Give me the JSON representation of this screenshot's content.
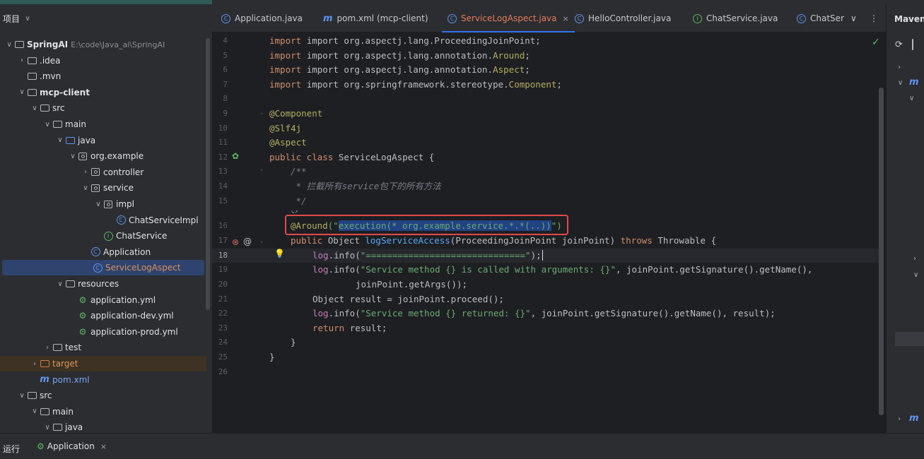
{
  "project_panel": {
    "title": "项目",
    "tree": [
      {
        "label": "SpringAI",
        "path": "E:\\code\\Java_ai\\SpringAI",
        "type": "module",
        "depth": 0,
        "expanded": true
      },
      {
        "label": ".idea",
        "type": "folder",
        "depth": 1,
        "expanded": false
      },
      {
        "label": ".mvn",
        "type": "folder",
        "depth": 1,
        "leaf": true
      },
      {
        "label": "mcp-client",
        "type": "module",
        "depth": 1,
        "expanded": true
      },
      {
        "label": "src",
        "type": "folder",
        "depth": 2,
        "expanded": true
      },
      {
        "label": "main",
        "type": "folder",
        "depth": 3,
        "expanded": true
      },
      {
        "label": "java",
        "type": "source-folder",
        "depth": 4,
        "expanded": true
      },
      {
        "label": "org.example",
        "type": "package",
        "depth": 5,
        "expanded": true
      },
      {
        "label": "controller",
        "type": "package",
        "depth": 6,
        "expanded": false
      },
      {
        "label": "service",
        "type": "package",
        "depth": 6,
        "expanded": true
      },
      {
        "label": "impl",
        "type": "package",
        "depth": 7,
        "expanded": true
      },
      {
        "label": "ChatServiceImpl",
        "type": "class",
        "depth": 8
      },
      {
        "label": "ChatService",
        "type": "interface",
        "depth": 7
      },
      {
        "label": "Application",
        "type": "class-run",
        "depth": 6
      },
      {
        "label": "ServiceLogAspect",
        "type": "class",
        "depth": 6,
        "selected": true
      },
      {
        "label": "resources",
        "type": "resources",
        "depth": 4,
        "expanded": true
      },
      {
        "label": "application.yml",
        "type": "yml",
        "depth": 5
      },
      {
        "label": "application-dev.yml",
        "type": "yml",
        "depth": 5
      },
      {
        "label": "application-prod.yml",
        "type": "yml",
        "depth": 5
      },
      {
        "label": "test",
        "type": "folder",
        "depth": 3,
        "expanded": false
      },
      {
        "label": "target",
        "type": "excluded",
        "depth": 2,
        "expanded": false,
        "highlight": true
      },
      {
        "label": "pom.xml",
        "type": "maven",
        "depth": 2
      },
      {
        "label": "src",
        "type": "folder",
        "depth": 1,
        "expanded": true
      },
      {
        "label": "main",
        "type": "folder",
        "depth": 2,
        "expanded": true
      },
      {
        "label": "java",
        "type": "folder",
        "depth": 3,
        "expanded": true
      }
    ]
  },
  "tabs": [
    {
      "label": "Application.java",
      "icon": "class-run-icon"
    },
    {
      "label": "pom.xml (mcp-client)",
      "icon": "maven-icon"
    },
    {
      "label": "ServiceLogAspect.java",
      "icon": "class-icon",
      "active": true
    },
    {
      "label": "HelloController.java",
      "icon": "class-icon"
    },
    {
      "label": "ChatService.java",
      "icon": "interface-icon"
    },
    {
      "label": "ChatSer",
      "icon": "class-icon"
    }
  ],
  "tab_close_glyph": "×",
  "editor": {
    "current_line": 18,
    "line_numbers": [
      "4",
      "5",
      "6",
      "7",
      "8",
      "9",
      "10",
      "11",
      "12",
      "13",
      "14",
      "15",
      "",
      "16",
      "17",
      "18",
      "19",
      "20",
      "21",
      "22",
      "23",
      "24",
      "25",
      "26"
    ],
    "code": {
      "l4": "import org.aspectj.lang.ProceedingJoinPoint;",
      "l5_a": "import org.aspectj.lang.annotation.",
      "l5_b": "Around",
      "l5_c": ";",
      "l6_a": "import org.aspectj.lang.annotation.",
      "l6_b": "Aspect",
      "l6_c": ";",
      "l7_a": "import org.springframework.stereotype.",
      "l7_b": "Component",
      "l7_c": ";",
      "l9": "@Component",
      "l10": "@Slf4j",
      "l11": "@Aspect",
      "l12_a": "public class ",
      "l12_b": "ServiceLogAspect {",
      "l13": "/**",
      "l14": " * 拦截所有service包下的所有方法",
      "l15": " */",
      "l15b": "↘↗",
      "l16_a": "@Around",
      "l16_b": "(\"",
      "l16_c": "execution(* org.example.service.*.*(..))",
      "l16_d": "\")",
      "l17_a": "public ",
      "l17_b": "Object ",
      "l17_c": "logServiceAccess",
      "l17_d": "(ProceedingJoinPoint joinPoint) ",
      "l17_e": "throws ",
      "l17_f": "Throwable {",
      "l18_a": "log",
      "l18_b": ".info(",
      "l18_c": "\"==============================\"",
      "l18_d": ");",
      "l19_a": "log",
      "l19_b": ".info(",
      "l19_c": "\"Service method {} is called with arguments: {}\"",
      "l19_d": ", joinPoint.getSignature().getName(),",
      "l20": "joinPoint.getArgs());",
      "l21": "Object result = joinPoint.proceed();",
      "l22_a": "log",
      "l22_b": ".info(",
      "l22_c": "\"Service method {} returned: {}\"",
      "l22_d": ", joinPoint.getSignature().getName(), result);",
      "l23_a": "return ",
      "l23_b": "result;",
      "l24": "}",
      "l25": "}"
    }
  },
  "maven_panel": {
    "title": "Maven"
  },
  "bottom": {
    "run_label": "运行",
    "run_tab": "Application",
    "close_glyph": "×"
  }
}
